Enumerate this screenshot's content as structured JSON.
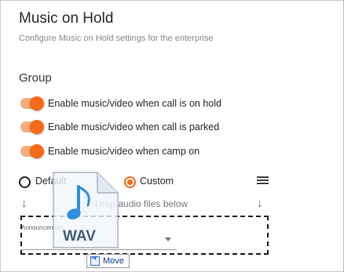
{
  "header": {
    "title": "Music on Hold",
    "subtitle": "Configure Music on Hold settings for the enterprise"
  },
  "group": {
    "title": "Group",
    "toggles": [
      {
        "label": "Enable music/video when call is on hold",
        "on": true
      },
      {
        "label": "Enable music/video when call is parked",
        "on": true
      },
      {
        "label": "Enable music/video when camp on",
        "on": true
      }
    ]
  },
  "source": {
    "default_label": "Default",
    "custom_label": "Custom",
    "selected": "Custom"
  },
  "upload": {
    "drop_text": "Drop audio files below",
    "select_label": "Announcement"
  },
  "drag": {
    "file_type": "WAV",
    "tooltip": "Move"
  },
  "colors": {
    "accent": "#f56a16",
    "accent_light": "#f6ad7e"
  },
  "icons": {
    "menu": "menu-icon",
    "arrow": "arrow-down-icon",
    "file": "audio-file-icon"
  }
}
